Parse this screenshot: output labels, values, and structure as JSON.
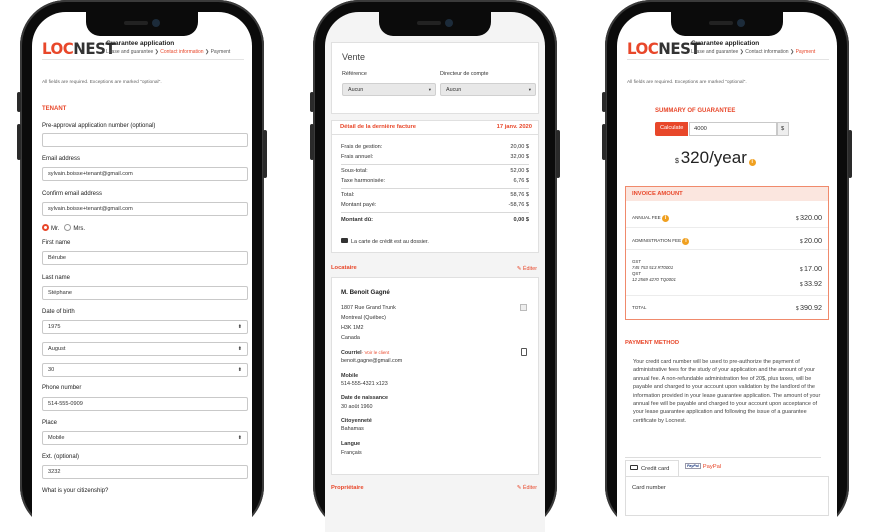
{
  "phone1": {
    "logo_a": "LOC",
    "logo_b": "NEST",
    "title": "Guarantee application",
    "crumb1": "Lease and guarantee",
    "crumb2": "Contact information",
    "crumb3": "Payment",
    "required_note": "All fields are required. Exceptions are marked \"optional\".",
    "section": "TENANT",
    "preapproval_label": "Pre-approval application number (optional)",
    "preapproval_value": "",
    "email_label": "Email address",
    "email_value": "sylvain.boisse+tenant@gmail.com",
    "confirm_label": "Confirm email address",
    "confirm_value": "sylvain.boisse+tenant@gmail.com",
    "mr": "Mr.",
    "mrs": "Mrs.",
    "first_label": "First name",
    "first_value": "Bérube",
    "last_label": "Last name",
    "last_value": "Stéphane",
    "dob_label": "Date of birth",
    "dob_year": "1975",
    "dob_month": "August",
    "dob_day": "30",
    "phone_label": "Phone number",
    "phone_value": "514-555-0909",
    "place_label": "Place",
    "place_value": "Mobile",
    "ext_label": "Ext. (optional)",
    "ext_value": "3232",
    "citizenship_label": "What is your citizenship?"
  },
  "phone2": {
    "vente": "Vente",
    "reference_label": "Référence",
    "reference_value": "Aucun",
    "director_label": "Directeur de compte",
    "director_value": "Aucun",
    "invoice_title": "Détail de la dernière facture",
    "invoice_date": "17 janv. 2020",
    "rows": [
      {
        "label": "Frais de gestion:",
        "value": "20,00 $"
      },
      {
        "label": "Frais annuel:",
        "value": "32,00 $"
      },
      {
        "label": "Sous-total:",
        "value": "52,00 $"
      },
      {
        "label": "Taxe harmonisée:",
        "value": "6,76 $"
      },
      {
        "label": "Total:",
        "value": "58,76 $"
      },
      {
        "label": "Montant payé:",
        "value": "-58,76 $"
      },
      {
        "label": "Montant dû:",
        "value": "0,00 $"
      }
    ],
    "card_note": "La carte de crédit est au dossier.",
    "tenant_section": "Locataire",
    "edit": "Éditer",
    "tenant_name": "M. Benoit Gagné",
    "address": [
      "1807 Rue Grand Trunk",
      "Montreal (Québec)",
      "H3K 1M2",
      "Canada"
    ],
    "email_label": "Courriel",
    "email_hint": "- Voir le client",
    "email_value": "benoit.gagne@gmail.com",
    "mobile_label": "Mobile",
    "mobile_value": "514-555-4321 x123",
    "birth_label": "Date de naissance",
    "birth_value": "30 août 1960",
    "citizen_label": "Citoyenneté",
    "citizen_value": "Bahamas",
    "lang_label": "Langue",
    "lang_value": "Français",
    "owner_section": "Propriétaire",
    "owner_edit": "Éditer"
  },
  "phone3": {
    "logo_a": "LOC",
    "logo_b": "NEST",
    "title": "Guarantee application",
    "crumb1": "Lease and guarantee",
    "crumb2": "Contact information",
    "crumb3": "Payment",
    "required_note": "All fields are required. Exceptions are marked \"optional\".",
    "summary_title": "SUMMARY OF GUARANTEE",
    "calc_label": "Calculate",
    "calc_value": "4000",
    "currency": "$",
    "price_currency": "$",
    "price": "320/year",
    "invoice_title": "INVOICE AMOUNT",
    "annual_label": "ANNUAL FEE",
    "annual_value": "320.00",
    "admin_label": "ADMINISTRATION FEE",
    "admin_value": "20.00",
    "gst_label": "GST",
    "gst_num": "745 753 513 RT0001",
    "gst_value": "17.00",
    "qst_label": "QST",
    "qst_num": "12 2569 4270 TQ0001",
    "qst_value": "33.92",
    "total_label": "TOTAL",
    "total_value": "390.92",
    "payment_title": "PAYMENT METHOD",
    "payment_text": "Your credit card number will be used to pre-authorize the payment of administrative fees for the study of your application and the amount of your annual fee. A non-refundable administration fee of 20$, plus taxes, will be payable and charged to your account upon validation by the landlord of the information provided in your lease guarantee application. The amount of your annual fee will be payable and charged to your account upon acceptance of your lease guarantee application and following the issue of a guarantee certificate by Locnest.",
    "tab_card": "Credit card",
    "tab_paypal_icon": "PayPal",
    "tab_paypal": "PayPal",
    "card_number_label": "Card number"
  }
}
